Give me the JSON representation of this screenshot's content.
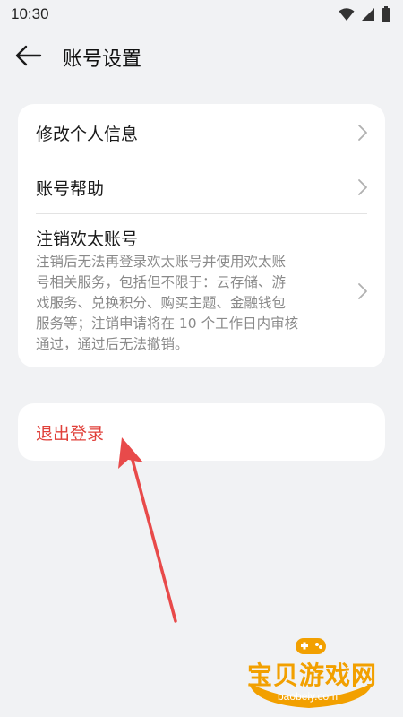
{
  "status_bar": {
    "time": "10:30",
    "icons": [
      "wifi-icon",
      "cellular-signal-icon",
      "battery-icon"
    ]
  },
  "header": {
    "back_icon": "back-arrow-icon",
    "title": "账号设置"
  },
  "settings_list": {
    "items": [
      {
        "label": "修改个人信息",
        "icon": "chevron-right-icon"
      },
      {
        "label": "账号帮助",
        "icon": "chevron-right-icon"
      },
      {
        "label": "注销欢太账号",
        "description_lines": [
          "注销后无法再登录欢太账号并使用欢太账",
          "号相关服务，包括但不限于：云存储、游",
          "戏服务、兑换积分、购买主题、金融钱包",
          "服务等；注销申请将在 10 个工作日内审核",
          "通过，通过后无法撤销。"
        ],
        "icon": "chevron-right-icon"
      }
    ]
  },
  "logout": {
    "label": "退出登录",
    "color": "#e0403a"
  },
  "annotation": {
    "type": "arrow",
    "color": "#e84a4a"
  },
  "watermark": {
    "text": "宝贝游戏网",
    "url": "baobeiy.com"
  }
}
